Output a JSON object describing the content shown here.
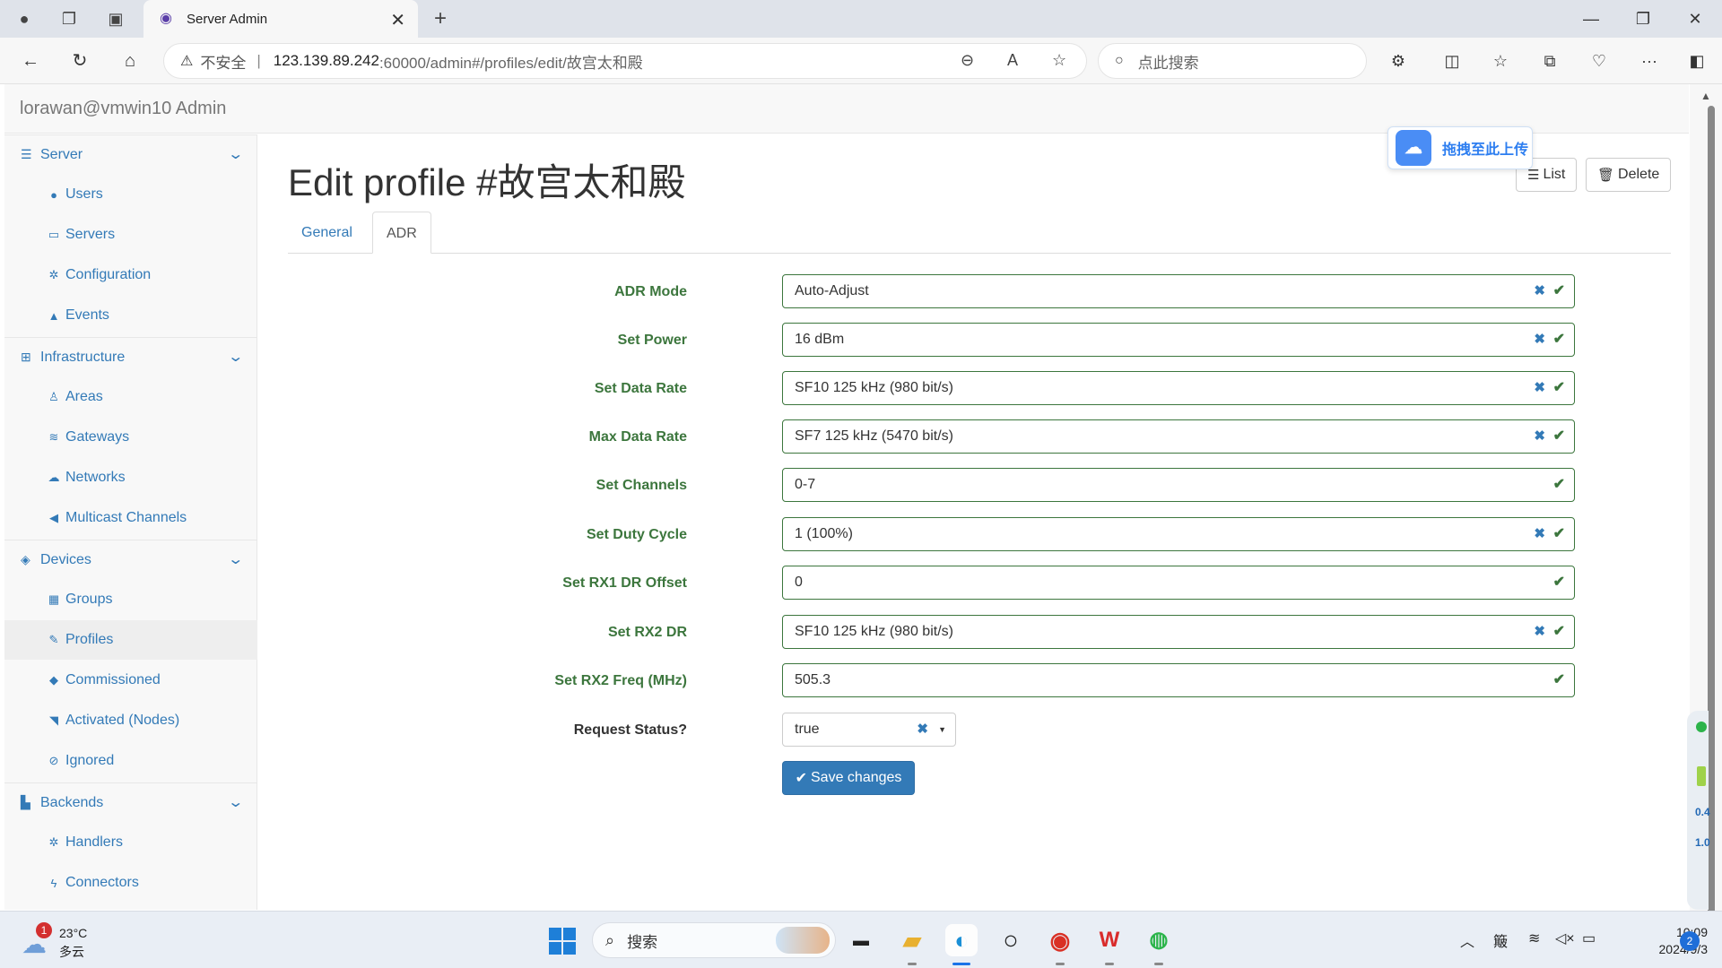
{
  "browser": {
    "tab_title": "Server Admin",
    "url_warning": "不安全",
    "url_host": "123.139.89.242",
    "url_rest": ":60000/admin#/profiles/edit/故宫太和殿",
    "search_placeholder": "点此搜索"
  },
  "app": {
    "brand": "lorawan@vmwin10 Admin"
  },
  "sidebar": {
    "sections": [
      {
        "label": "Server",
        "icon": "server-icon"
      },
      {
        "label": "Infrastructure",
        "icon": "sitemap-icon"
      },
      {
        "label": "Devices",
        "icon": "cubes-icon"
      },
      {
        "label": "Backends",
        "icon": "chart-icon"
      }
    ],
    "items": [
      {
        "label": "Users",
        "icon": "user-icon"
      },
      {
        "label": "Servers",
        "icon": "desktop-icon"
      },
      {
        "label": "Configuration",
        "icon": "gear-icon"
      },
      {
        "label": "Events",
        "icon": "warning-icon"
      },
      {
        "label": "Areas",
        "icon": "male-icon"
      },
      {
        "label": "Gateways",
        "icon": "wifi-icon"
      },
      {
        "label": "Networks",
        "icon": "cloud-icon"
      },
      {
        "label": "Multicast Channels",
        "icon": "bullhorn-icon"
      },
      {
        "label": "Groups",
        "icon": "grid-icon"
      },
      {
        "label": "Profiles",
        "icon": "edit-icon"
      },
      {
        "label": "Commissioned",
        "icon": "cube-icon"
      },
      {
        "label": "Activated (Nodes)",
        "icon": "rss-icon"
      },
      {
        "label": "Ignored",
        "icon": "ban-icon"
      },
      {
        "label": "Handlers",
        "icon": "cogs-icon"
      },
      {
        "label": "Connectors",
        "icon": "bolt-icon"
      }
    ]
  },
  "page": {
    "title": "Edit profile #故宫太和殿",
    "list_button": "List",
    "delete_button": "Delete",
    "upload_widget": "拖拽至此上传",
    "tabs": [
      {
        "label": "General"
      },
      {
        "label": "ADR"
      }
    ],
    "fields": [
      {
        "label": "ADR Mode",
        "value": "Auto-Adjust"
      },
      {
        "label": "Set Power",
        "value": "16 dBm"
      },
      {
        "label": "Set Data Rate",
        "value": "SF10 125 kHz (980 bit/s)"
      },
      {
        "label": "Max Data Rate",
        "value": "SF7 125 kHz (5470 bit/s)"
      },
      {
        "label": "Set Channels",
        "value": "0-7"
      },
      {
        "label": "Set Duty Cycle",
        "value": "1 (100%)"
      },
      {
        "label": "Set RX1 DR Offset",
        "value": "0"
      },
      {
        "label": "Set RX2 DR",
        "value": "SF10 125 kHz (980 bit/s)"
      },
      {
        "label": "Set RX2 Freq (MHz)",
        "value": "505.3"
      }
    ],
    "request_status": {
      "label": "Request Status?",
      "value": "true"
    },
    "save_button": "Save changes"
  },
  "side_widget": {
    "up": "0.4",
    "down": "1.0"
  },
  "taskbar": {
    "weather_temp": "23°C",
    "weather_cond": "多云",
    "weather_badge": "1",
    "search_label": "搜索",
    "tray_ime": "簸",
    "time": "10:09",
    "date": "2024/9/3",
    "notifications": "2"
  }
}
